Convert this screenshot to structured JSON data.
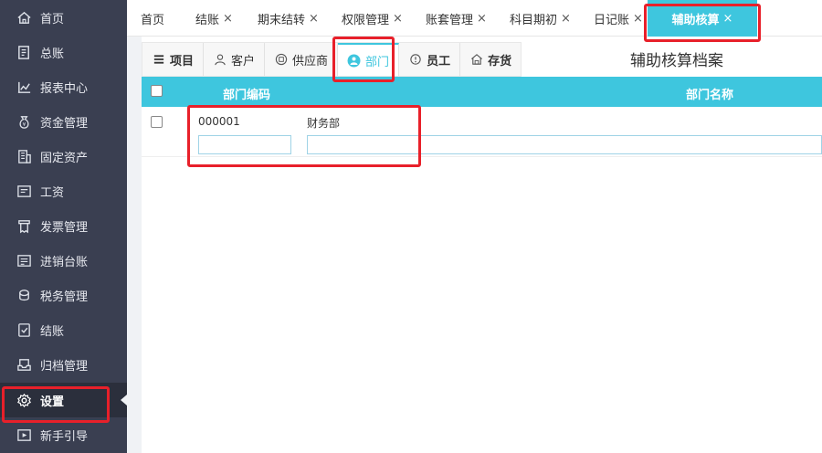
{
  "sidebar": {
    "items": [
      {
        "label": "首页",
        "icon": "home-icon"
      },
      {
        "label": "总账",
        "icon": "ledger-icon"
      },
      {
        "label": "报表中心",
        "icon": "chart-icon"
      },
      {
        "label": "资金管理",
        "icon": "money-bag-icon"
      },
      {
        "label": "固定资产",
        "icon": "building-icon"
      },
      {
        "label": "工资",
        "icon": "salary-icon"
      },
      {
        "label": "发票管理",
        "icon": "invoice-icon"
      },
      {
        "label": "进销台账",
        "icon": "inventory-icon"
      },
      {
        "label": "税务管理",
        "icon": "tax-icon"
      },
      {
        "label": "结账",
        "icon": "checkout-icon"
      },
      {
        "label": "归档管理",
        "icon": "archive-icon"
      },
      {
        "label": "设置",
        "icon": "gear-icon"
      },
      {
        "label": "新手引导",
        "icon": "guide-icon"
      }
    ],
    "active": "设置"
  },
  "tabs": [
    {
      "label": "首页",
      "closable": false
    },
    {
      "label": "结账",
      "closable": true
    },
    {
      "label": "期末结转",
      "closable": true
    },
    {
      "label": "权限管理",
      "closable": true
    },
    {
      "label": "账套管理",
      "closable": true
    },
    {
      "label": "科目期初",
      "closable": true
    },
    {
      "label": "日记账",
      "closable": true
    },
    {
      "label": "辅助核算",
      "closable": true,
      "active": true
    }
  ],
  "close_glyph": "×",
  "subtabs": [
    {
      "label": "项目",
      "icon": "list-icon"
    },
    {
      "label": "客户",
      "icon": "user-icon"
    },
    {
      "label": "供应商",
      "icon": "supplier-icon"
    },
    {
      "label": "部门",
      "icon": "department-icon",
      "active": true
    },
    {
      "label": "员工",
      "icon": "employee-icon"
    },
    {
      "label": "存货",
      "icon": "warehouse-icon"
    }
  ],
  "archive_title": "辅助核算档案",
  "table": {
    "headers": {
      "code": "部门编码",
      "name": "部门名称"
    },
    "rows": [
      {
        "code": "000001",
        "name": "财务部"
      }
    ],
    "new_row": {
      "code": "",
      "name": ""
    }
  },
  "colors": {
    "accent": "#3ec6de",
    "sidebar_bg": "#3a3f51",
    "highlight": "#e8202a"
  }
}
